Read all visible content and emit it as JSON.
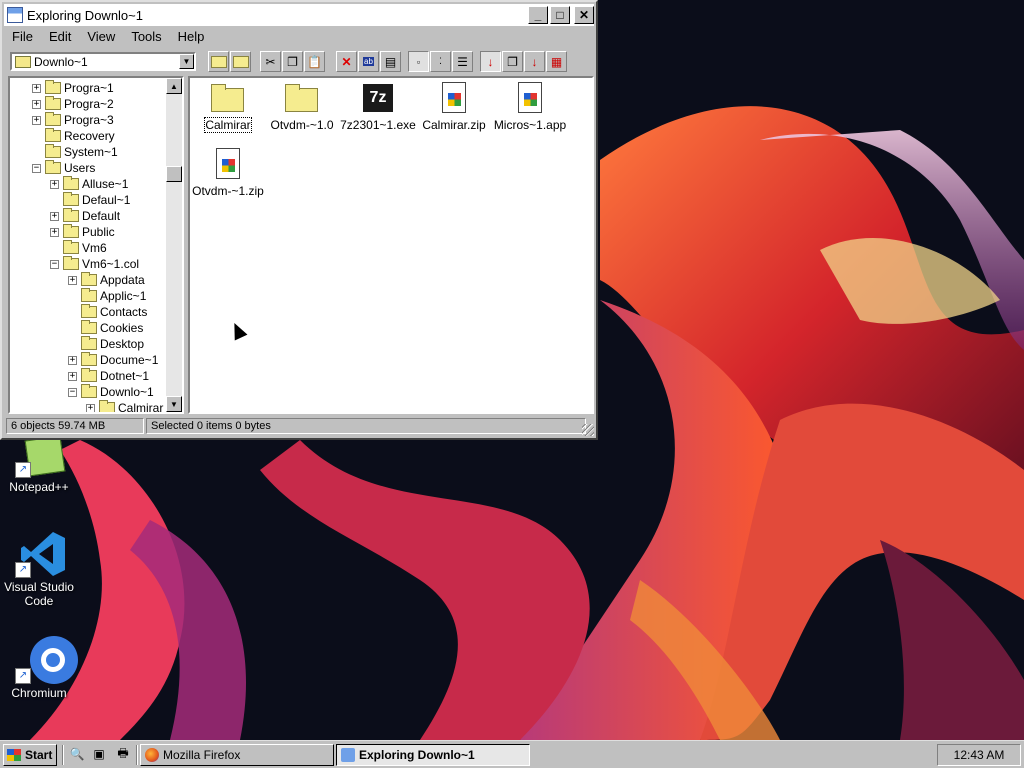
{
  "window": {
    "title": "Exploring Downlo~1",
    "minimize": "_",
    "maximize": "□",
    "close": "✕"
  },
  "menu": [
    "File",
    "Edit",
    "View",
    "Tools",
    "Help"
  ],
  "address": {
    "value": "Downlo~1"
  },
  "toolbar_icons": [
    "up-folder-icon",
    "map-drive-icon",
    "cut-icon",
    "copy-icon",
    "paste-icon",
    "delete-icon",
    "properties-icon",
    "rename-icon",
    "large-icons-icon",
    "small-icons-icon",
    "list-icon",
    "details-icon",
    "sort-name-icon",
    "sort-type-icon",
    "sort-size-icon",
    "sort-date-icon"
  ],
  "tree": [
    {
      "label": "Progra~1",
      "level": 1,
      "exp": "+"
    },
    {
      "label": "Progra~2",
      "level": 1,
      "exp": "+"
    },
    {
      "label": "Progra~3",
      "level": 1,
      "exp": "+"
    },
    {
      "label": "Recovery",
      "level": 1,
      "exp": ""
    },
    {
      "label": "System~1",
      "level": 1,
      "exp": ""
    },
    {
      "label": "Users",
      "level": 1,
      "exp": "-"
    },
    {
      "label": "Alluse~1",
      "level": 2,
      "exp": "+"
    },
    {
      "label": "Defaul~1",
      "level": 2,
      "exp": ""
    },
    {
      "label": "Default",
      "level": 2,
      "exp": "+"
    },
    {
      "label": "Public",
      "level": 2,
      "exp": "+"
    },
    {
      "label": "Vm6",
      "level": 2,
      "exp": ""
    },
    {
      "label": "Vm6~1.col",
      "level": 2,
      "exp": "-"
    },
    {
      "label": "Appdata",
      "level": 3,
      "exp": "+"
    },
    {
      "label": "Applic~1",
      "level": 3,
      "exp": ""
    },
    {
      "label": "Contacts",
      "level": 3,
      "exp": ""
    },
    {
      "label": "Cookies",
      "level": 3,
      "exp": ""
    },
    {
      "label": "Desktop",
      "level": 3,
      "exp": ""
    },
    {
      "label": "Docume~1",
      "level": 3,
      "exp": "+"
    },
    {
      "label": "Dotnet~1",
      "level": 3,
      "exp": "+"
    },
    {
      "label": "Downlo~1",
      "level": 3,
      "exp": "-"
    },
    {
      "label": "Calmirar",
      "level": 4,
      "exp": "+"
    }
  ],
  "files": [
    {
      "label": "Calmirar",
      "type": "folder",
      "selected": true
    },
    {
      "label": "Otvdm-~1.0",
      "type": "folder",
      "selected": false
    },
    {
      "label": "7z2301~1.exe",
      "type": "7z",
      "selected": false
    },
    {
      "label": "Calmirar.zip",
      "type": "doc",
      "selected": false
    },
    {
      "label": "Micros~1.app",
      "type": "doc",
      "selected": false
    },
    {
      "label": "Otvdm-~1.zip",
      "type": "doc",
      "selected": false
    }
  ],
  "status": {
    "objects": "6 objects  59.74 MB",
    "selected": "Selected 0 items  0 bytes"
  },
  "desktop_icons": [
    {
      "label": "Notepad++",
      "icon": "notepadpp-icon"
    },
    {
      "label": "Visual Studio Code",
      "icon": "vscode-icon"
    },
    {
      "label": "Chromium",
      "icon": "chromium-icon"
    }
  ],
  "taskbar": {
    "start": "Start",
    "tasks": [
      {
        "label": "Mozilla Firefox",
        "active": false
      },
      {
        "label": "Exploring Downlo~1",
        "active": true
      }
    ],
    "clock": "12:43 AM"
  },
  "colors": {
    "window_face": "#c0c0c0",
    "folder": "#f5ec8f",
    "desktop": "#0b0d1a"
  }
}
